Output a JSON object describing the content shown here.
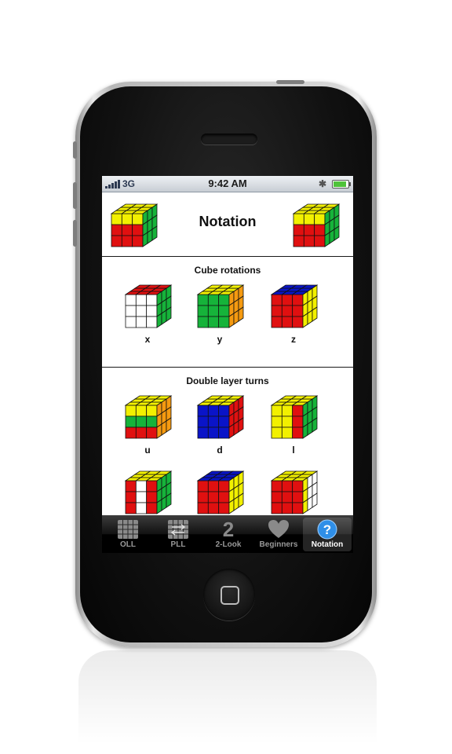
{
  "status_bar": {
    "network": "3G",
    "time": "9:42 AM",
    "battery_level": 0.9
  },
  "header": {
    "title": "Notation"
  },
  "cube_rotations": {
    "title": "Cube rotations",
    "items": [
      {
        "label": "x"
      },
      {
        "label": "y"
      },
      {
        "label": "z"
      }
    ]
  },
  "double_layer_turns": {
    "title": "Double layer turns",
    "items": [
      {
        "label": "u"
      },
      {
        "label": "d"
      },
      {
        "label": "l"
      },
      {
        "label": ""
      },
      {
        "label": ""
      },
      {
        "label": ""
      }
    ]
  },
  "tab_bar": {
    "tabs": [
      {
        "label": "OLL",
        "icon": "grid-icon"
      },
      {
        "label": "PLL",
        "icon": "grid-arrows-icon"
      },
      {
        "label": "2-Look",
        "icon": "number-two-icon",
        "glyph": "2"
      },
      {
        "label": "Beginners",
        "icon": "heart-icon"
      },
      {
        "label": "Notation",
        "icon": "question-icon"
      }
    ],
    "active": "Notation"
  },
  "colors": {
    "cube_red": "#e01010",
    "cube_green": "#16b33a",
    "cube_yellow": "#f2f000",
    "cube_blue": "#0a14c8",
    "cube_orange": "#f59a10",
    "cube_white": "#ffffff",
    "tab_active_icon": "#2f8fe8"
  }
}
